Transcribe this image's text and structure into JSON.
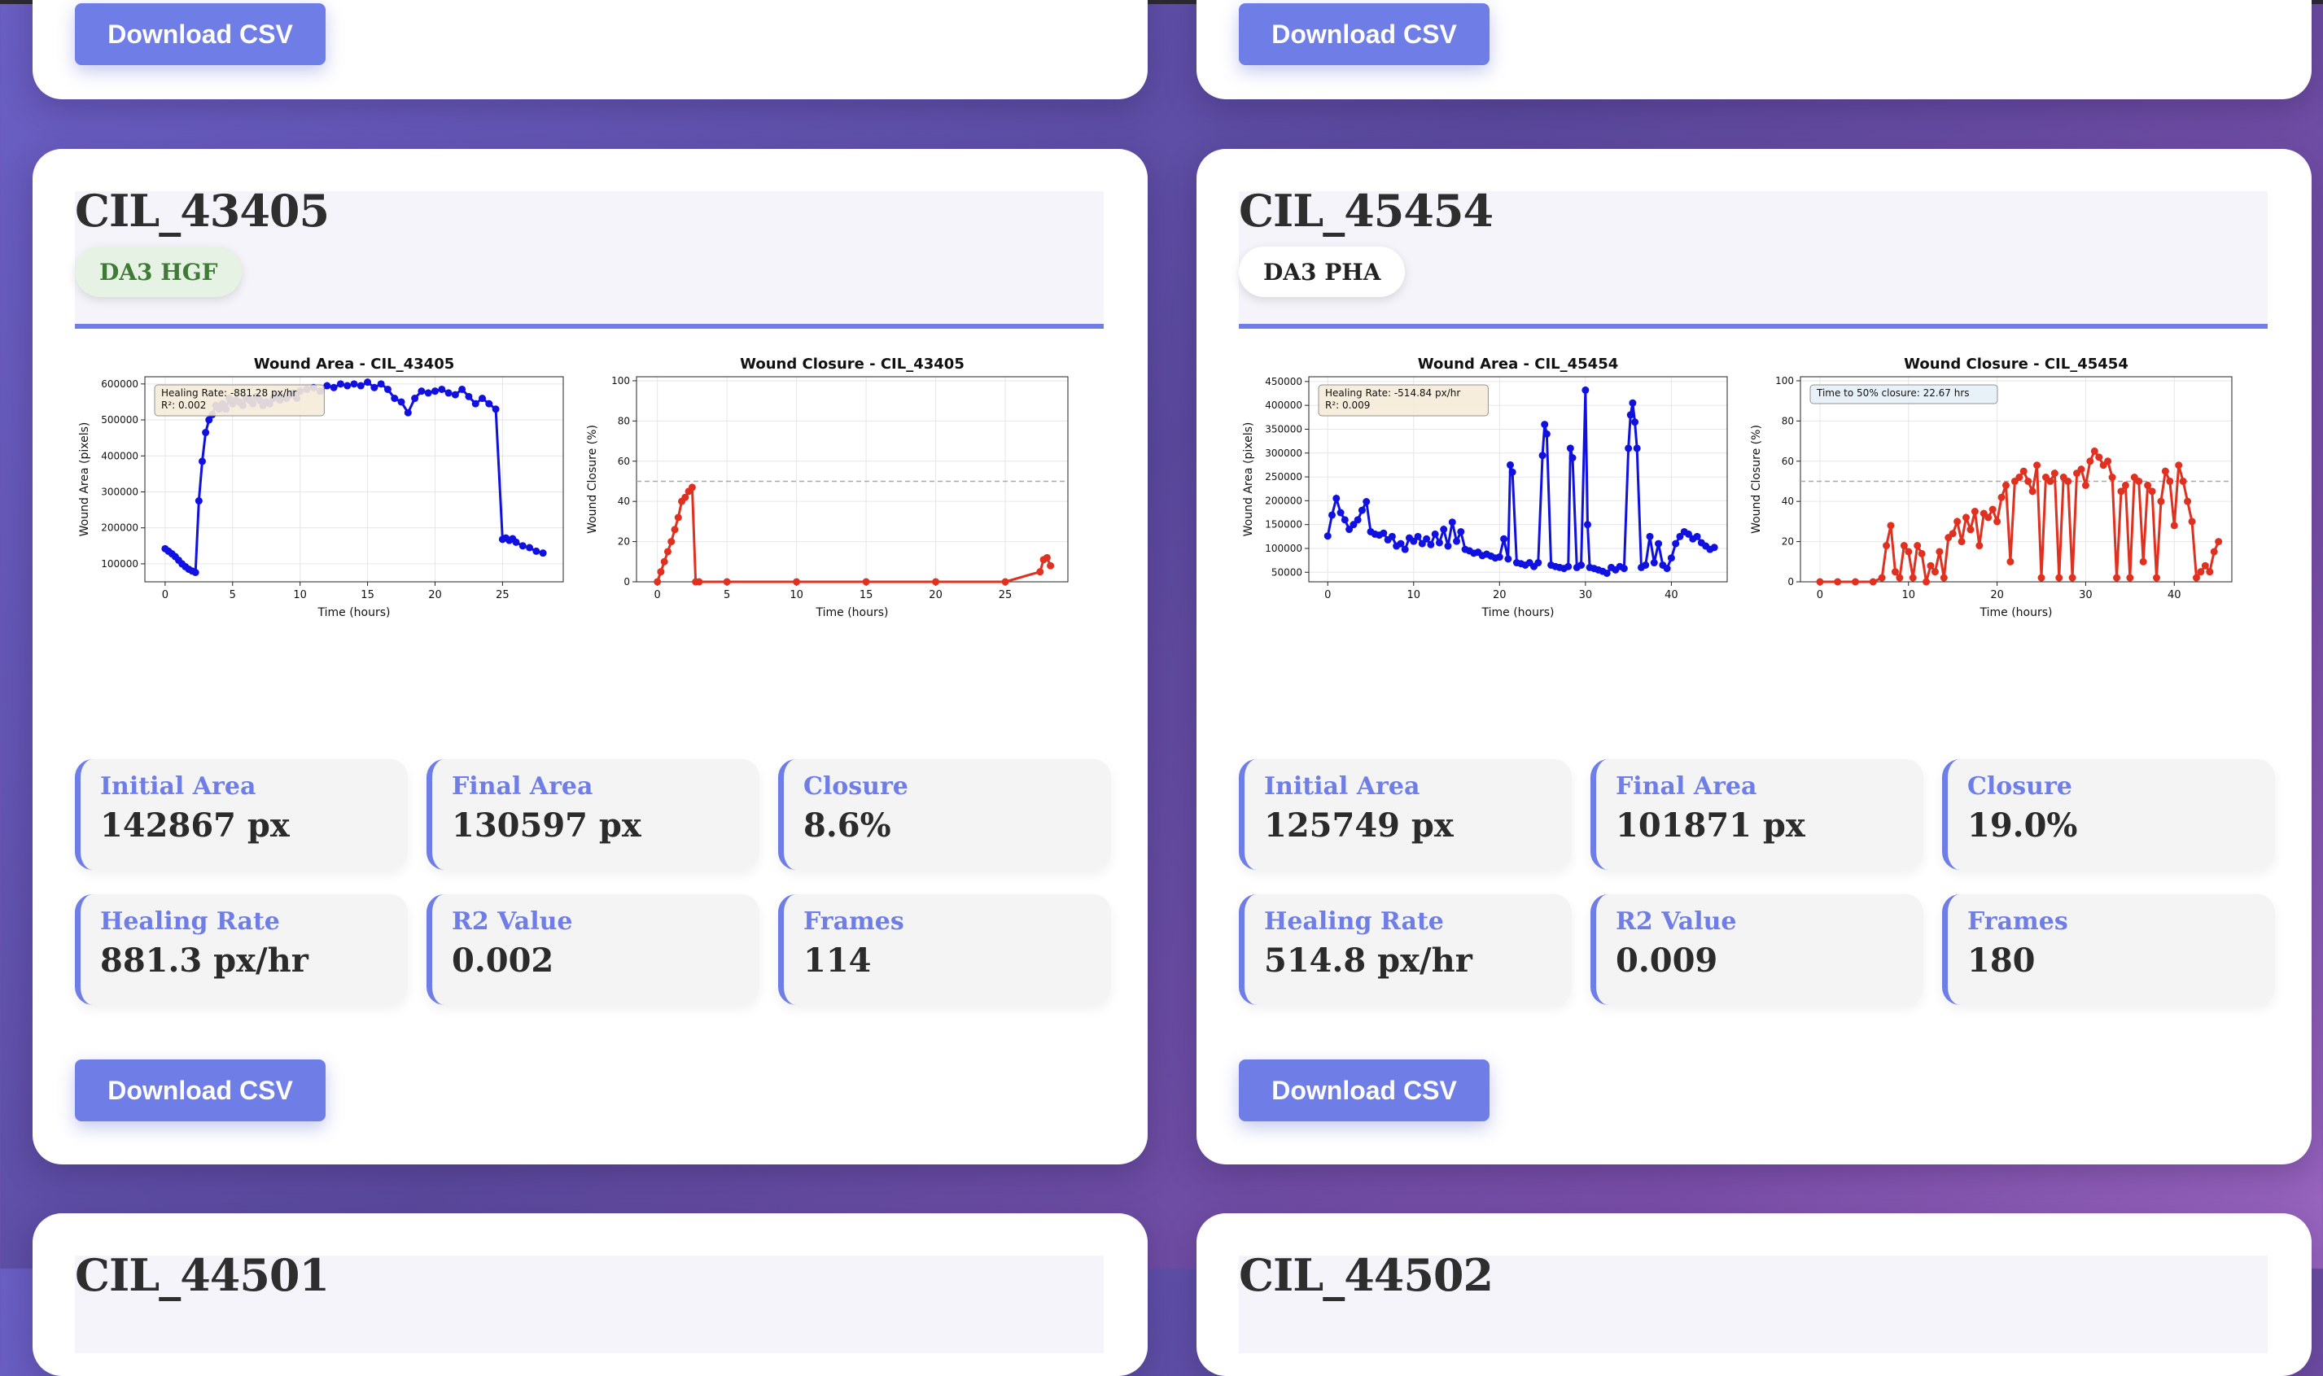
{
  "download_label": "Download CSV",
  "colors": {
    "accent": "#6f7ee6",
    "area_line": "#1010e0",
    "closure_line": "#e03020"
  },
  "cards": [
    {
      "id": "CIL_43405",
      "tag": "DA3 HGF",
      "area_chart": {
        "title": "Wound Area - CIL_43405",
        "xlabel": "Time (hours)",
        "ylabel": "Wound Area (pixels)",
        "annotation_rate": "Healing Rate: -881.28 px/hr",
        "annotation_r2": "R²: 0.002"
      },
      "closure_chart": {
        "title": "Wound Closure - CIL_43405",
        "xlabel": "Time (hours)",
        "ylabel": "Wound Closure (%)"
      },
      "stats": [
        {
          "label": "Initial Area",
          "value": "142867 px"
        },
        {
          "label": "Final Area",
          "value": "130597 px"
        },
        {
          "label": "Closure",
          "value": "8.6%"
        },
        {
          "label": "Healing Rate",
          "value": "881.3 px/hr"
        },
        {
          "label": "R2 Value",
          "value": "0.002"
        },
        {
          "label": "Frames",
          "value": "114"
        }
      ]
    },
    {
      "id": "CIL_45454",
      "tag": "DA3 PHA",
      "area_chart": {
        "title": "Wound Area - CIL_45454",
        "xlabel": "Time (hours)",
        "ylabel": "Wound Area (pixels)",
        "annotation_rate": "Healing Rate: -514.84 px/hr",
        "annotation_r2": "R²: 0.009"
      },
      "closure_chart": {
        "title": "Wound Closure - CIL_45454",
        "xlabel": "Time (hours)",
        "ylabel": "Wound Closure (%)",
        "annotation": "Time to 50% closure: 22.67 hrs"
      },
      "stats": [
        {
          "label": "Initial Area",
          "value": "125749 px"
        },
        {
          "label": "Final Area",
          "value": "101871 px"
        },
        {
          "label": "Closure",
          "value": "19.0%"
        },
        {
          "label": "Healing Rate",
          "value": "514.8 px/hr"
        },
        {
          "label": "R2 Value",
          "value": "0.009"
        },
        {
          "label": "Frames",
          "value": "180"
        }
      ]
    }
  ],
  "partial_cards": [
    {
      "id": "CIL_44501"
    },
    {
      "id": "CIL_44502"
    }
  ],
  "chart_data": [
    {
      "type": "line",
      "title": "Wound Area - CIL_43405",
      "xlabel": "Time (hours)",
      "ylabel": "Wound Area (pixels)",
      "xlim": [
        -1.5,
        29.5
      ],
      "ylim": [
        50000,
        620000
      ],
      "xticks": [
        0,
        5,
        10,
        15,
        20,
        25
      ],
      "yticks": [
        100000,
        200000,
        300000,
        400000,
        500000,
        600000
      ],
      "ytick_labels": [
        "100000",
        "200000",
        "300000",
        "400000",
        "500000",
        "600000"
      ],
      "grid": true,
      "series": [
        {
          "color": "#1010e0",
          "x": [
            0,
            0.25,
            0.5,
            0.75,
            1,
            1.25,
            1.5,
            1.75,
            2,
            2.25,
            2.5,
            2.75,
            3,
            3.25,
            3.5,
            3.75,
            4,
            4.25,
            4.5,
            4.75,
            5,
            5.25,
            5.5,
            5.75,
            6,
            6.25,
            6.5,
            6.75,
            7,
            7.25,
            7.5,
            7.75,
            8,
            8.25,
            8.5,
            8.75,
            9,
            9.25,
            9.5,
            9.75,
            10,
            10.5,
            11,
            11.5,
            12,
            12.5,
            13,
            13.5,
            14,
            14.5,
            15,
            15.5,
            16,
            16.5,
            17,
            17.5,
            18,
            18.5,
            19,
            19.5,
            20,
            20.5,
            21,
            21.5,
            22,
            22.5,
            23,
            23.5,
            24,
            24.5,
            25,
            25.25,
            25.5,
            25.75,
            26,
            26.5,
            27,
            27.5,
            28
          ],
          "y": [
            142000,
            135000,
            128000,
            120000,
            110000,
            100000,
            92000,
            85000,
            80000,
            76000,
            275000,
            385000,
            465000,
            500000,
            515000,
            540000,
            530000,
            545000,
            530000,
            560000,
            545000,
            555000,
            550000,
            540000,
            560000,
            555000,
            545000,
            565000,
            555000,
            540000,
            550000,
            545000,
            560000,
            570000,
            555000,
            565000,
            560000,
            570000,
            575000,
            560000,
            580000,
            585000,
            590000,
            580000,
            595000,
            590000,
            600000,
            595000,
            600000,
            595000,
            605000,
            590000,
            600000,
            585000,
            560000,
            550000,
            520000,
            560000,
            580000,
            575000,
            580000,
            585000,
            575000,
            570000,
            585000,
            565000,
            545000,
            560000,
            545000,
            530000,
            168000,
            172000,
            165000,
            170000,
            160000,
            150000,
            145000,
            135000,
            130000
          ]
        }
      ]
    },
    {
      "type": "line",
      "title": "Wound Closure - CIL_43405",
      "xlabel": "Time (hours)",
      "ylabel": "Wound Closure (%)",
      "xlim": [
        -1.5,
        29.5
      ],
      "ylim": [
        0,
        102
      ],
      "xticks": [
        0,
        5,
        10,
        15,
        20,
        25
      ],
      "yticks": [
        0,
        20,
        40,
        60,
        80,
        100
      ],
      "grid": true,
      "hline": 50,
      "series": [
        {
          "color": "#e03020",
          "x": [
            0,
            0.25,
            0.5,
            0.75,
            1,
            1.25,
            1.5,
            1.75,
            2,
            2.25,
            2.5,
            2.75,
            3,
            5,
            10,
            15,
            20,
            25,
            27.5,
            27.75,
            28,
            28.25
          ],
          "y": [
            0,
            5,
            10,
            15,
            20,
            26,
            32,
            40,
            42,
            45,
            47,
            0,
            0,
            0,
            0,
            0,
            0,
            0,
            5,
            11,
            12,
            8
          ]
        }
      ]
    },
    {
      "type": "line",
      "title": "Wound Area - CIL_45454",
      "xlabel": "Time (hours)",
      "ylabel": "Wound Area (pixels)",
      "xlim": [
        -2.2,
        46.5
      ],
      "ylim": [
        30000,
        460000
      ],
      "xticks": [
        0,
        10,
        20,
        30,
        40
      ],
      "yticks": [
        50000,
        100000,
        150000,
        200000,
        250000,
        300000,
        350000,
        400000,
        450000
      ],
      "grid": true,
      "series": [
        {
          "color": "#1010e0",
          "x": [
            0,
            0.5,
            1,
            1.5,
            2,
            2.5,
            3,
            3.5,
            4,
            4.5,
            5,
            5.5,
            6,
            6.5,
            7,
            7.5,
            8,
            8.5,
            9,
            9.5,
            10,
            10.5,
            11,
            11.5,
            12,
            12.5,
            13,
            13.5,
            14,
            14.5,
            15,
            15.5,
            16,
            16.5,
            17,
            17.5,
            18,
            18.5,
            19,
            19.5,
            20,
            20.5,
            21,
            21.25,
            21.5,
            22,
            22.5,
            23,
            23.5,
            24,
            24.5,
            25,
            25.25,
            25.5,
            26,
            26.5,
            27,
            27.5,
            28,
            28.25,
            28.5,
            29,
            29.5,
            30,
            30.25,
            30.5,
            31,
            31.5,
            32,
            32.5,
            33,
            33.5,
            34,
            34.5,
            35,
            35.25,
            35.5,
            35.75,
            36,
            36.5,
            37,
            37.5,
            38,
            38.5,
            39,
            39.5,
            40,
            40.5,
            41,
            41.5,
            42,
            42.5,
            43,
            43.5,
            44,
            44.5,
            45
          ],
          "y": [
            126000,
            170000,
            205000,
            175000,
            160000,
            140000,
            150000,
            160000,
            180000,
            198000,
            135000,
            130000,
            128000,
            132000,
            118000,
            125000,
            105000,
            110000,
            98000,
            122000,
            115000,
            125000,
            110000,
            120000,
            108000,
            130000,
            112000,
            140000,
            105000,
            155000,
            115000,
            135000,
            98000,
            95000,
            90000,
            92000,
            85000,
            88000,
            84000,
            80000,
            82000,
            120000,
            78000,
            275000,
            260000,
            70000,
            68000,
            65000,
            70000,
            62000,
            70000,
            295000,
            360000,
            340000,
            65000,
            62000,
            60000,
            58000,
            62000,
            310000,
            290000,
            60000,
            65000,
            432000,
            150000,
            60000,
            58000,
            55000,
            52000,
            48000,
            60000,
            55000,
            62000,
            58000,
            310000,
            380000,
            405000,
            365000,
            310000,
            60000,
            65000,
            125000,
            70000,
            110000,
            65000,
            58000,
            80000,
            110000,
            125000,
            135000,
            130000,
            120000,
            125000,
            112000,
            105000,
            98000,
            102000
          ]
        }
      ]
    },
    {
      "type": "line",
      "title": "Wound Closure - CIL_45454",
      "xlabel": "Time (hours)",
      "ylabel": "Wound Closure (%)",
      "xlim": [
        -2.2,
        46.5
      ],
      "ylim": [
        0,
        102
      ],
      "xticks": [
        0,
        10,
        20,
        30,
        40
      ],
      "yticks": [
        0,
        20,
        40,
        60,
        80,
        100
      ],
      "grid": true,
      "hline": 50,
      "series": [
        {
          "color": "#e03020",
          "x": [
            0,
            2,
            4,
            6,
            7,
            7.5,
            8,
            8.5,
            9,
            9.5,
            10,
            10.5,
            11,
            11.5,
            12,
            12.5,
            13,
            13.5,
            14,
            14.5,
            15,
            15.5,
            16,
            16.5,
            17,
            17.5,
            18,
            18.5,
            19,
            19.5,
            20,
            20.5,
            21,
            21.5,
            22,
            22.5,
            23,
            23.5,
            24,
            24.5,
            25,
            25.5,
            26,
            26.5,
            27,
            27.5,
            28,
            28.5,
            29,
            29.5,
            30,
            30.5,
            31,
            31.5,
            32,
            32.5,
            33,
            33.5,
            34,
            34.5,
            35,
            35.5,
            36,
            36.5,
            37,
            37.5,
            38,
            38.5,
            39,
            39.5,
            40,
            40.5,
            41,
            41.5,
            42,
            42.5,
            43,
            43.5,
            44,
            44.5,
            45
          ],
          "y": [
            0,
            0,
            0,
            0,
            2,
            18,
            28,
            5,
            2,
            18,
            15,
            2,
            18,
            14,
            0,
            8,
            5,
            15,
            2,
            22,
            24,
            30,
            20,
            32,
            26,
            35,
            18,
            34,
            32,
            36,
            30,
            42,
            48,
            10,
            50,
            52,
            55,
            50,
            45,
            58,
            2,
            52,
            50,
            54,
            2,
            52,
            50,
            2,
            54,
            56,
            48,
            60,
            65,
            62,
            58,
            60,
            52,
            2,
            45,
            48,
            2,
            52,
            50,
            10,
            48,
            45,
            2,
            40,
            55,
            50,
            28,
            58,
            50,
            40,
            30,
            2,
            5,
            8,
            5,
            15,
            20
          ]
        }
      ]
    }
  ]
}
